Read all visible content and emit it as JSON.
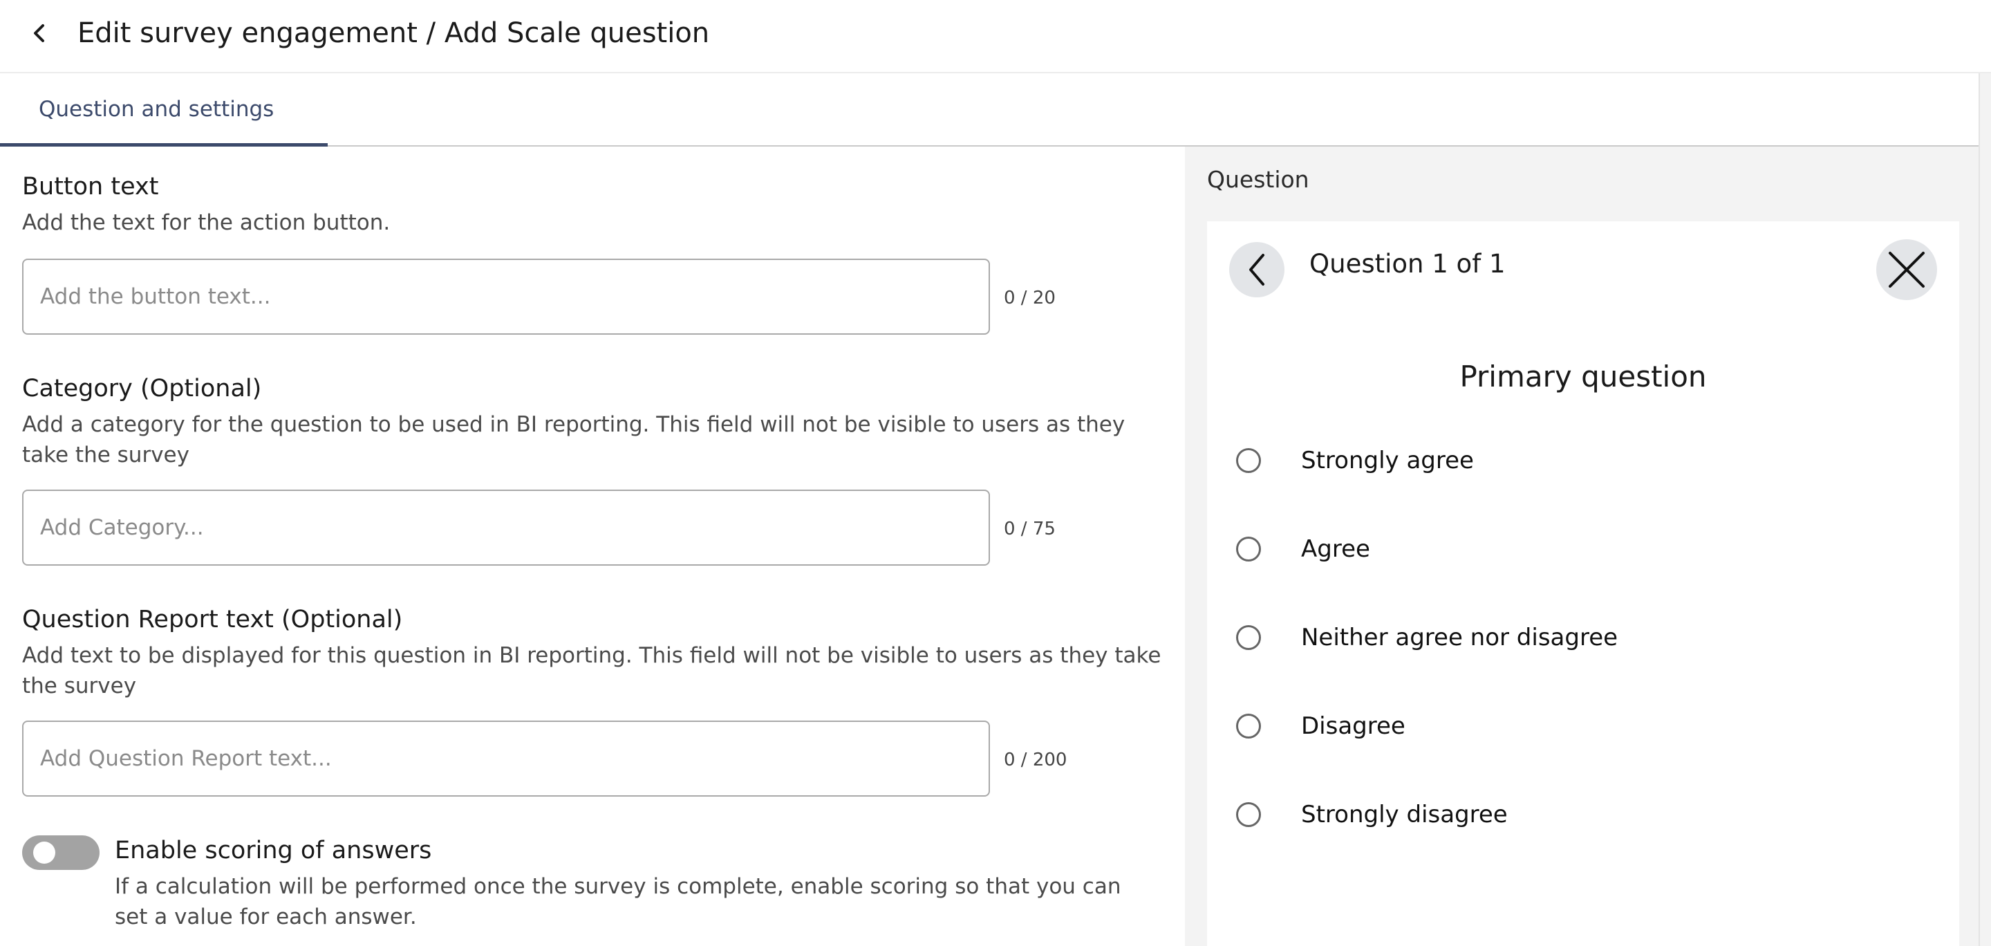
{
  "header": {
    "title": "Edit survey engagement / Add Scale question",
    "back_icon": "chevron-left-icon"
  },
  "tabs": [
    {
      "label": "Question and settings",
      "active": true
    }
  ],
  "form": {
    "button_text": {
      "title": "Button text",
      "description": "Add the text for the action button.",
      "value": "",
      "placeholder": "Add the button text...",
      "counter": "0 / 20"
    },
    "category": {
      "title": "Category (Optional)",
      "description": "Add a category for the question to be used in BI reporting. This field will not be visible to users as they take the survey",
      "value": "",
      "placeholder": "Add Category...",
      "counter": "0 / 75"
    },
    "report_text": {
      "title": "Question Report text (Optional)",
      "description": "Add text to be displayed for this question in BI reporting. This field will not be visible to users as they take the survey",
      "value": "",
      "placeholder": "Add Question Report text...",
      "counter": "0 / 200"
    },
    "scoring": {
      "title": "Enable scoring of answers",
      "description": "If a calculation will be performed once the survey is complete, enable scoring so that you can set a value for each answer.",
      "enabled": false
    }
  },
  "preview": {
    "label": "Question",
    "counter": "Question 1 of 1",
    "prev_icon": "chevron-left-icon",
    "close_icon": "close-icon",
    "primary_question": "Primary question",
    "options": [
      {
        "label": "Strongly agree"
      },
      {
        "label": "Agree"
      },
      {
        "label": "Neither agree nor disagree"
      },
      {
        "label": "Disagree"
      },
      {
        "label": "Strongly disagree"
      }
    ]
  },
  "colors": {
    "tab_accent": "#3c4a6b",
    "toggle_off": "#a3a3a3",
    "preview_bg": "#f3f3f3",
    "circle_button_bg": "#e3e5e8"
  }
}
